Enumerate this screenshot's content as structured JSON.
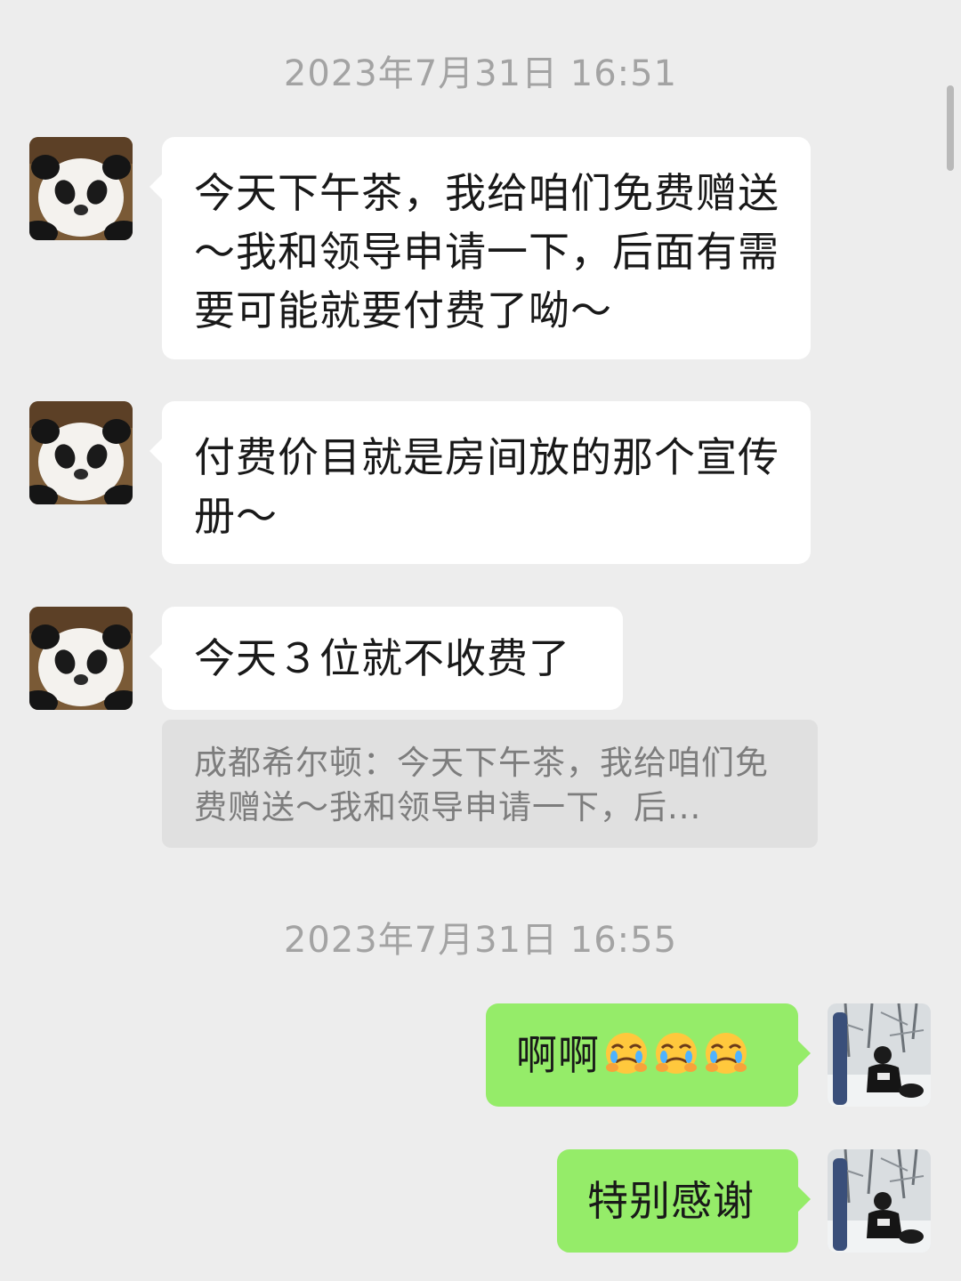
{
  "chat": {
    "timestamps": [
      "2023年7月31日 16:51",
      "2023年7月31日 16:55"
    ],
    "messages": [
      {
        "side": "left",
        "text": "今天下午茶，我给咱们免费赠送～我和领导申请一下，后面有需要可能就要付费了呦～"
      },
      {
        "side": "left",
        "text": "付费价目就是房间放的那个宣传册～"
      },
      {
        "side": "left",
        "text": "今天３位就不收费了"
      },
      {
        "side": "right",
        "text": "啊啊",
        "emojis": [
          "face-holding-back-tears-icon",
          "face-holding-back-tears-icon",
          "face-holding-back-tears-icon"
        ]
      },
      {
        "side": "right",
        "text": "特别感谢"
      }
    ],
    "quote": {
      "text": "成都希尔顿：今天下午茶，我给咱们免费赠送～我和领导申请一下，后..."
    }
  },
  "colors": {
    "background": "#ededed",
    "incoming_bubble": "#ffffff",
    "outgoing_bubble": "#95ec69",
    "timestamp": "#a3a3a3",
    "quote_bg": "#e0e0e0"
  }
}
